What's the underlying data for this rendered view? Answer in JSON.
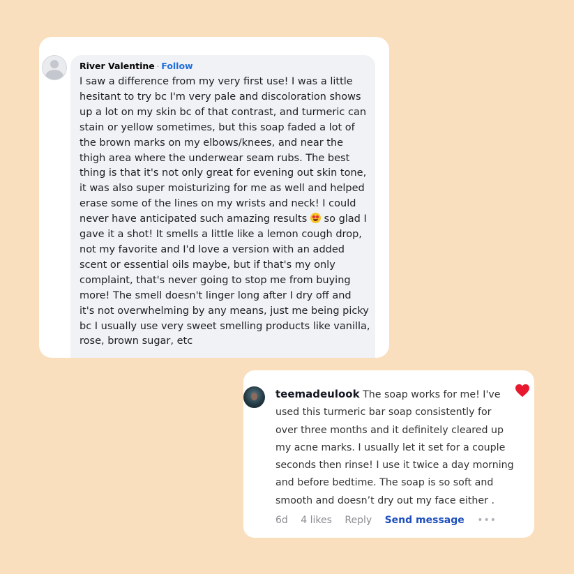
{
  "facebook_comment": {
    "name": "River Valentine",
    "separator": "·",
    "follow_label": "Follow",
    "lines": [
      "I saw a difference from my very first use! I was a little",
      "hesitant to try bc I'm very pale and discoloration shows",
      "up a lot on my skin bc of that contrast, and turmeric can",
      "stain or yellow sometimes, but this soap faded a lot of",
      "the brown marks on my elbows/knees, and near the",
      "thigh area where the underwear seam rubs. The best",
      "thing is that it's not only great for evening out skin tone,",
      "it was also super moisturizing for me as well and helped",
      "erase some of the lines on my wrists and neck! I could",
      "never have anticipated such amazing results",
      "so glad I",
      "gave it a shot! It smells a little like a lemon cough drop,",
      "not my favorite and I'd love a version with an added",
      "scent or essential oils maybe, but if that's my only",
      "complaint, that's never going to stop me from buying",
      "more! The smell doesn't linger long after I dry off and",
      "it's not overwhelming by any means, just me being picky",
      "bc I usually use very sweet smelling products like vanilla,",
      "rose, brown sugar, etc"
    ],
    "emoji": "heart-eyes-emoji"
  },
  "tiktok_comment": {
    "username": "teemadeulook",
    "lines": [
      "The soap works for me! I've",
      "used this turmeric bar soap consistently for",
      "over three months and it definitely cleared up",
      "my acne marks. I usually let it set for a couple",
      "seconds then rinse! I use it twice a day morning",
      "and before bedtime. The soap is so soft and",
      "smooth and doesn’t dry out my face either ."
    ],
    "time": "6d",
    "likes": "4 likes",
    "reply_label": "Reply",
    "send_message_label": "Send message",
    "more_label": "•••",
    "liked": true,
    "heart_color": "#e8182f"
  }
}
